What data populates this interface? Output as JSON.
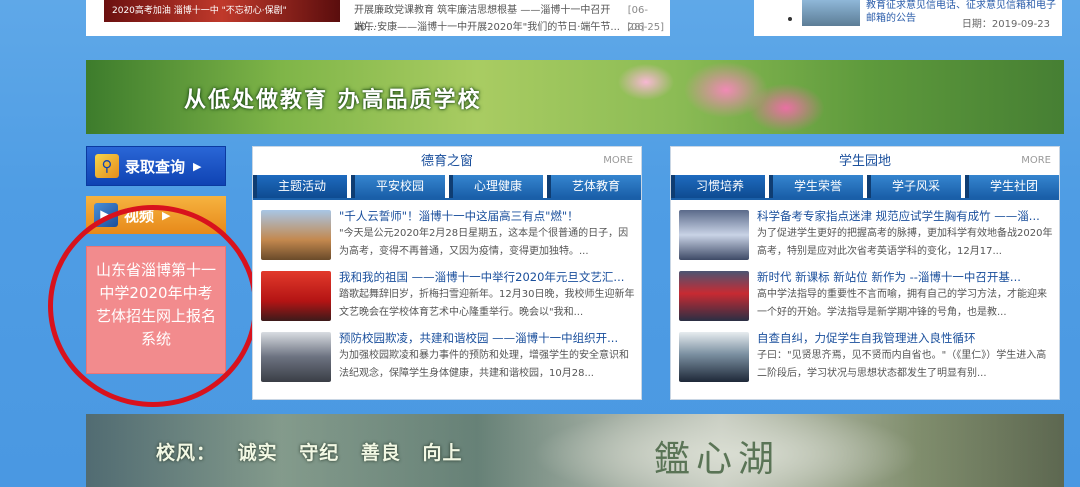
{
  "top_left": {
    "thumb_caption": "2020高考加油   淄博十一中 \"不忘初心·保剧\"",
    "news": [
      {
        "title": "开展廉政党课教育 筑牢廉洁思想根基 ——淄博十一中召开20...",
        "date": "[06-28]"
      },
      {
        "title": "端午·安康——淄博十一中开展2020年\"我们的节日·端午节...",
        "date": "[06-25]"
      }
    ]
  },
  "top_right": {
    "text": "教育征求意见信电话、征求意见信箱和电子邮箱的公告",
    "date": "日期：2019-09-23"
  },
  "banner": {
    "slogan": "从低处做教育   办高品质学校"
  },
  "sidebar": {
    "admission_label": "录取查询",
    "orange_label": "视频",
    "pink_card_text": "山东省淄博第十一中学2020年中考艺体招生网上报名系统"
  },
  "moral_panel": {
    "title": "德育之窗",
    "more": "MORE",
    "tabs": [
      "主题活动",
      "平安校园",
      "心理健康",
      "艺体教育"
    ],
    "items": [
      {
        "title": "\"千人云誓师\"！淄博十一中这届高三有点\"燃\"！",
        "desc": "\"今天是公元2020年2月28日星期五，这本是个很普通的日子，因为高考，变得不再普通，又因为疫情，变得更加独特。..."
      },
      {
        "title": "我和我的祖国 ——淄博十一中举行2020年元旦文艺汇...",
        "desc": "踏歌起舞辞旧岁，折梅扫雪迎新年。12月30日晚，我校师生迎新年文艺晚会在学校体育艺术中心隆重举行。晚会以\"我和..."
      },
      {
        "title": "预防校园欺凌，共建和谐校园 ——淄博十一中组织开...",
        "desc": "为加强校园欺凌和暴力事件的预防和处理，增强学生的安全意识和法纪观念，保障学生身体健康，共建和谐校园，10月28..."
      }
    ]
  },
  "student_panel": {
    "title": "学生园地",
    "more": "MORE",
    "tabs": [
      "习惯培养",
      "学生荣誉",
      "学子风采",
      "学生社团"
    ],
    "items": [
      {
        "title": "科学备考专家指点迷津 规范应试学生胸有成竹 ——淄...",
        "desc": "为了促进学生更好的把握高考的脉搏，更加科学有效地备战2020年高考，特别是应对此次省考英语学科的变化，12月17..."
      },
      {
        "title": "新时代  新课标  新站位  新作为 --淄博十一中召开基...",
        "desc": "高中学法指导的重要性不言而喻，拥有自己的学习方法，才能迎来一个好的开始。学法指导是新学期冲锋的号角，也是教..."
      },
      {
        "title": "自查自纠，力促学生自我管理进入良性循环",
        "desc": "子曰：\"见贤思齐焉，见不贤而内自省也。\"（《里仁》）学生进入高二阶段后，学习状况与思想状态都发生了明显有别..."
      }
    ]
  },
  "bottom_banner": {
    "motto": "校风： 诚实  守纪  善良  向上",
    "lake": "鑑心湖"
  }
}
